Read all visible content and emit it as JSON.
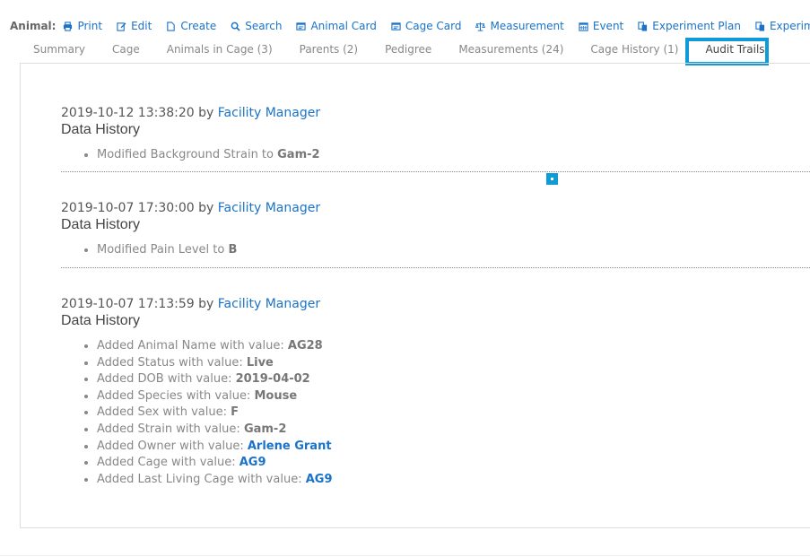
{
  "toolbar": {
    "label": "Animal:",
    "buttons": [
      {
        "label": "Print",
        "icon": "print-icon"
      },
      {
        "label": "Edit",
        "icon": "edit-icon"
      },
      {
        "label": "Create",
        "icon": "file-icon"
      },
      {
        "label": "Search",
        "icon": "search-icon"
      },
      {
        "label": "Animal Card",
        "icon": "card-icon"
      },
      {
        "label": "Cage Card",
        "icon": "card-icon"
      },
      {
        "label": "Measurement",
        "icon": "scale-icon"
      },
      {
        "label": "Event",
        "icon": "calendar-icon"
      },
      {
        "label": "Experiment Plan",
        "icon": "copy-icon"
      },
      {
        "label": "Experiment",
        "icon": "copy-icon"
      }
    ]
  },
  "tabs": [
    {
      "label": "Summary"
    },
    {
      "label": "Cage"
    },
    {
      "label": "Animals in Cage (3)"
    },
    {
      "label": "Parents (2)"
    },
    {
      "label": "Pedigree"
    },
    {
      "label": "Measurements (24)"
    },
    {
      "label": "Cage History (1)"
    },
    {
      "label": "Audit Trails",
      "active": true
    }
  ],
  "audit": {
    "by_text": "by",
    "entries": [
      {
        "timestamp": "2019-10-12 13:38:20",
        "user": "Facility Manager",
        "title": "Data History",
        "items": [
          {
            "text": "Modified Background Strain to ",
            "value": "Gam-2"
          }
        ]
      },
      {
        "timestamp": "2019-10-07 17:30:00",
        "user": "Facility Manager",
        "title": "Data History",
        "items": [
          {
            "text": "Modified Pain Level to ",
            "value": "B"
          }
        ]
      },
      {
        "timestamp": "2019-10-07 17:13:59",
        "user": "Facility Manager",
        "title": "Data History",
        "items": [
          {
            "text": "Added Animal Name with value: ",
            "value": "AG28"
          },
          {
            "text": "Added Status with value: ",
            "value": "Live"
          },
          {
            "text": "Added DOB with value: ",
            "value": "2019-04-02"
          },
          {
            "text": "Added Species with value: ",
            "value": "Mouse"
          },
          {
            "text": "Added Sex with value: ",
            "value": "F"
          },
          {
            "text": "Added Strain with value: ",
            "value": "Gam-2"
          },
          {
            "text": "Added Owner with value: ",
            "value": "Arlene Grant",
            "link": true
          },
          {
            "text": "Added Cage with value: ",
            "value": "AG9",
            "link": true
          },
          {
            "text": "Added Last Living Cage with value: ",
            "value": "AG9",
            "link": true
          }
        ]
      }
    ]
  },
  "colors": {
    "link": "#1a73c8",
    "highlight": "#0f9ad8"
  }
}
